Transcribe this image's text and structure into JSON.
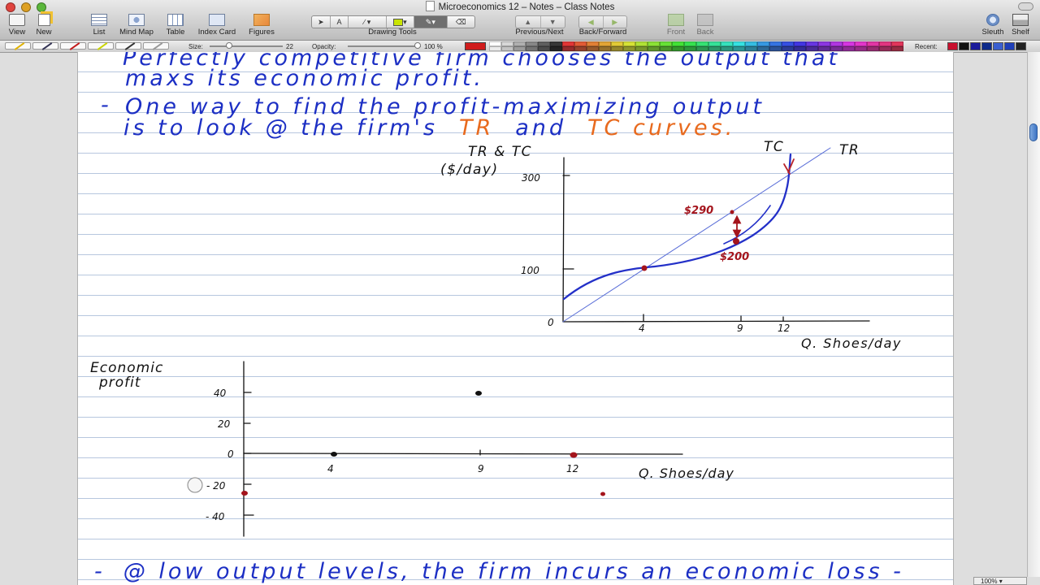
{
  "window": {
    "title": "Microeconomics 12 – Notes – Class Notes"
  },
  "toolbar": {
    "view": "View",
    "new": "New",
    "list": "List",
    "mind_map": "Mind Map",
    "table": "Table",
    "index_card": "Index Card",
    "figures": "Figures",
    "drawing_tools": "Drawing Tools",
    "previous_next": "Previous/Next",
    "back_forward": "Back/Forward",
    "front": "Front",
    "back": "Back",
    "sleuth": "Sleuth",
    "shelf": "Shelf",
    "text_tool": "A"
  },
  "drawbar": {
    "size_label": "Size:",
    "size_value": "22",
    "opacity_label": "Opacity:",
    "opacity_value": "100 %",
    "recent_label": "Recent:",
    "current_color": "#d01c1c",
    "recent_colors": [
      "#c8102e",
      "#111111",
      "#1b1b9a",
      "#0d2a8a",
      "#3a5fd0",
      "#1f3fb8",
      "#222222"
    ]
  },
  "notes": {
    "line1": "Perfectly competitive firm chooses the output that",
    "line2": "maxs its economic profit.",
    "bullet": "-",
    "line3": "One way to find the profit-maximizing output",
    "line4_a": "is to look @ the firm's",
    "line4_tr": "TR",
    "line4_and": "and",
    "line4_tc": "TC curves.",
    "bottom_line": "@ low output levels, the firm incurs an economic loss -",
    "colors": {
      "ink": "#1c2fc4",
      "accent": "#e86a1e",
      "red": "#a4141c"
    }
  },
  "graph_top": {
    "y_title_1": "TR & TC",
    "y_title_2": "($/day)",
    "curve_tc": "TC",
    "curve_tr": "TR",
    "y_ticks": [
      "300",
      "100",
      "0"
    ],
    "x_ticks": [
      "4",
      "9",
      "12"
    ],
    "x_label": "Q. Shoes/day",
    "annot_high": "$290",
    "annot_low": "$200"
  },
  "graph_bottom": {
    "y_title_1": "Economic",
    "y_title_2": "profit",
    "y_ticks": [
      "40",
      "20",
      "0",
      "- 20",
      "- 40"
    ],
    "x_ticks": [
      "4",
      "9",
      "12"
    ],
    "x_label": "Q. Shoes/day"
  },
  "status": {
    "zoom": "100%"
  }
}
